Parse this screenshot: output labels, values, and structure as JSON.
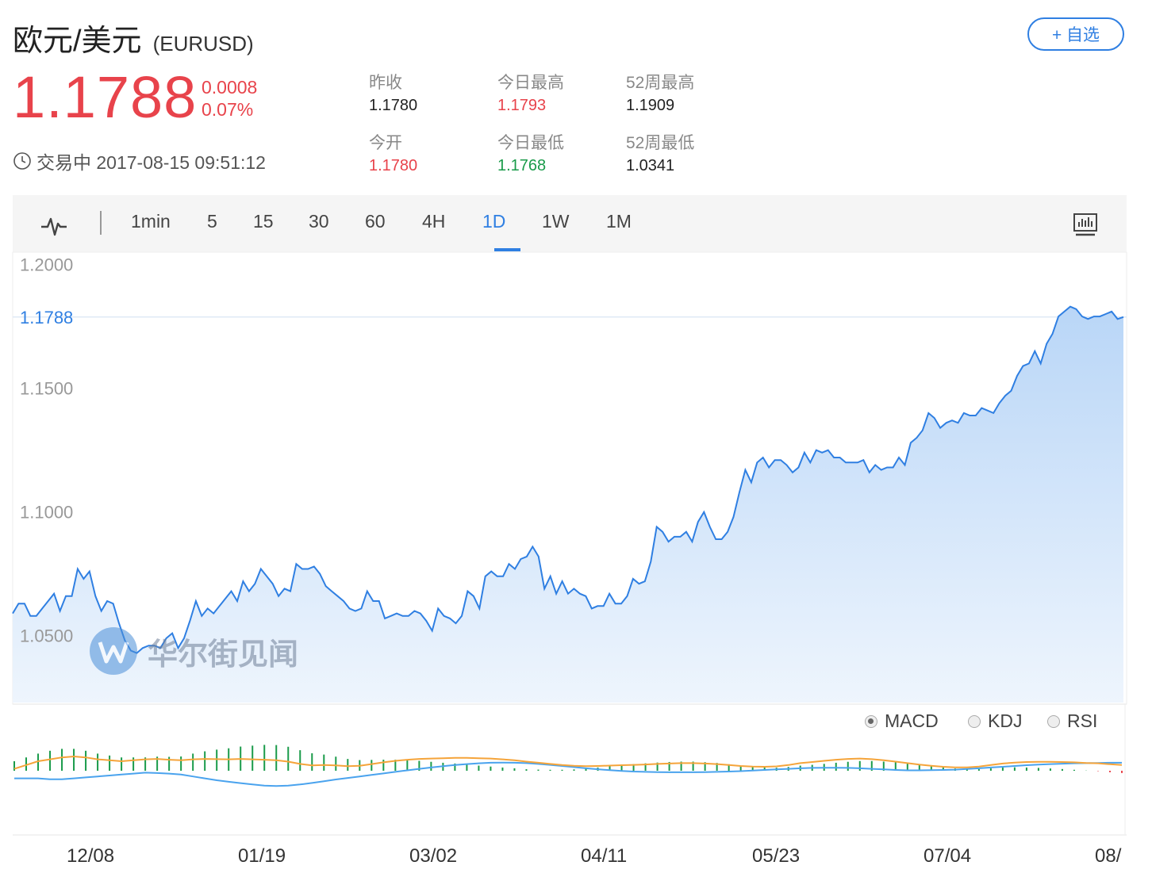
{
  "header": {
    "name": "欧元/美元",
    "code": "(EURUSD)",
    "watch_label": "+ 自选",
    "price": "1.1788",
    "change": "0.0008",
    "change_pct": "0.07%",
    "status": "交易中 2017-08-15 09:51:12"
  },
  "stats": [
    {
      "label": "昨收",
      "value": "1.1780",
      "tone": "neutral"
    },
    {
      "label": "今日最高",
      "value": "1.1793",
      "tone": "up"
    },
    {
      "label": "52周最高",
      "value": "1.1909",
      "tone": "neutral"
    },
    {
      "label": "今开",
      "value": "1.1780",
      "tone": "up"
    },
    {
      "label": "今日最低",
      "value": "1.1768",
      "tone": "down"
    },
    {
      "label": "52周最低",
      "value": "1.0341",
      "tone": "neutral"
    }
  ],
  "toolbar": {
    "periods": [
      "1min",
      "5",
      "15",
      "30",
      "60",
      "4H",
      "1D",
      "1W",
      "1M"
    ],
    "active": "1D",
    "left_icon": "line-chart-icon",
    "right_icon": "indicator-panel-icon"
  },
  "indicators": {
    "options": [
      "MACD",
      "KDJ",
      "RSI"
    ],
    "selected": "MACD"
  },
  "watermark": "华尔街见闻",
  "colors": {
    "up": "#e8434b",
    "down": "#1a9b4a",
    "accent": "#2f7fe2",
    "dif": "#4aa3ee",
    "dea": "#f5a43a"
  },
  "chart_data": {
    "type": "area",
    "y_ticks": [
      "1.2000",
      "1.1788",
      "1.1500",
      "1.1000",
      "1.0500"
    ],
    "x_ticks": [
      "12/08",
      "01/19",
      "03/02",
      "04/11",
      "05/23",
      "07/04",
      "08/"
    ],
    "ylim": [
      1.023,
      1.205
    ],
    "last_price_line": 1.1788,
    "values": [
      1.059,
      1.063,
      1.063,
      1.058,
      1.058,
      1.061,
      1.064,
      1.067,
      1.06,
      1.066,
      1.066,
      1.077,
      1.073,
      1.076,
      1.066,
      1.06,
      1.064,
      1.063,
      1.055,
      1.048,
      1.044,
      1.043,
      1.045,
      1.046,
      1.046,
      1.045,
      1.049,
      1.051,
      1.045,
      1.049,
      1.056,
      1.064,
      1.058,
      1.061,
      1.059,
      1.062,
      1.065,
      1.068,
      1.064,
      1.072,
      1.068,
      1.071,
      1.077,
      1.074,
      1.071,
      1.066,
      1.069,
      1.068,
      1.079,
      1.077,
      1.077,
      1.078,
      1.075,
      1.07,
      1.068,
      1.066,
      1.064,
      1.061,
      1.06,
      1.061,
      1.068,
      1.064,
      1.064,
      1.057,
      1.058,
      1.059,
      1.058,
      1.058,
      1.06,
      1.059,
      1.056,
      1.052,
      1.061,
      1.058,
      1.057,
      1.055,
      1.058,
      1.068,
      1.066,
      1.061,
      1.074,
      1.076,
      1.074,
      1.074,
      1.079,
      1.077,
      1.081,
      1.082,
      1.086,
      1.082,
      1.069,
      1.074,
      1.067,
      1.072,
      1.067,
      1.069,
      1.067,
      1.066,
      1.061,
      1.062,
      1.062,
      1.067,
      1.063,
      1.063,
      1.066,
      1.073,
      1.071,
      1.072,
      1.08,
      1.094,
      1.092,
      1.088,
      1.09,
      1.09,
      1.092,
      1.088,
      1.096,
      1.1,
      1.094,
      1.089,
      1.089,
      1.092,
      1.098,
      1.108,
      1.117,
      1.112,
      1.12,
      1.122,
      1.118,
      1.121,
      1.121,
      1.119,
      1.116,
      1.118,
      1.124,
      1.12,
      1.125,
      1.124,
      1.125,
      1.122,
      1.122,
      1.12,
      1.12,
      1.12,
      1.121,
      1.116,
      1.119,
      1.117,
      1.118,
      1.118,
      1.122,
      1.119,
      1.128,
      1.13,
      1.133,
      1.14,
      1.138,
      1.134,
      1.136,
      1.137,
      1.136,
      1.14,
      1.139,
      1.139,
      1.142,
      1.141,
      1.14,
      1.144,
      1.147,
      1.149,
      1.155,
      1.159,
      1.16,
      1.165,
      1.16,
      1.168,
      1.172,
      1.179,
      1.181,
      1.183,
      1.182,
      1.179,
      1.178,
      1.179,
      1.179,
      1.18,
      1.181,
      1.178,
      1.1788
    ],
    "macd": {
      "dif": [
        -0.004,
        -0.004,
        -0.004,
        -0.0045,
        -0.0045,
        -0.004,
        -0.0035,
        -0.003,
        -0.0025,
        -0.002,
        -0.0015,
        -0.001,
        -0.0012,
        -0.0015,
        -0.002,
        -0.003,
        -0.004,
        -0.005,
        -0.0058,
        -0.0065,
        -0.0072,
        -0.0078,
        -0.008,
        -0.0078,
        -0.0072,
        -0.0064,
        -0.0055,
        -0.0046,
        -0.0038,
        -0.003,
        -0.0022,
        -0.0014,
        -0.0006,
        0.0002,
        0.001,
        0.0017,
        0.0024,
        0.003,
        0.0035,
        0.0039,
        0.0042,
        0.0043,
        0.0042,
        0.004,
        0.0036,
        0.0031,
        0.0025,
        0.0019,
        0.0013,
        0.0008,
        0.0003,
        -0.0001,
        -0.0004,
        -0.0006,
        -0.0007,
        -0.0008,
        -0.0008,
        -0.0008,
        -0.0007,
        -0.0006,
        -0.0004,
        -0.0002,
        0.0001,
        0.0004,
        0.0007,
        0.001,
        0.0013,
        0.0015,
        0.0016,
        0.0016,
        0.0015,
        0.0013,
        0.001,
        0.0007,
        0.0004,
        0.0002,
        0.0002,
        0.0003,
        0.0004,
        0.0006,
        0.0009,
        0.0013,
        0.0017,
        0.0021,
        0.0025,
        0.0029,
        0.0032,
        0.0035,
        0.0037,
        0.0039,
        0.004,
        0.0041,
        0.0042,
        0.0042
      ],
      "dea": [
        0.001,
        0.003,
        0.005,
        0.006,
        0.007,
        0.0075,
        0.007,
        0.006,
        0.0055,
        0.005,
        0.0055,
        0.006,
        0.0062,
        0.0058,
        0.0055,
        0.006,
        0.0062,
        0.0061,
        0.006,
        0.0062,
        0.006,
        0.0058,
        0.0055,
        0.0048,
        0.0036,
        0.0028,
        0.003,
        0.0028,
        0.0024,
        0.0026,
        0.0035,
        0.0044,
        0.0052,
        0.0058,
        0.0062,
        0.0064,
        0.0066,
        0.0068,
        0.0068,
        0.0066,
        0.0064,
        0.006,
        0.0055,
        0.0048,
        0.0042,
        0.0036,
        0.003,
        0.0026,
        0.0024,
        0.0025,
        0.0027,
        0.0029,
        0.0031,
        0.0033,
        0.0036,
        0.0038,
        0.004,
        0.004,
        0.0038,
        0.0035,
        0.003,
        0.0025,
        0.0022,
        0.0021,
        0.0023,
        0.003,
        0.004,
        0.0046,
        0.0052,
        0.0058,
        0.0062,
        0.0064,
        0.0061,
        0.0055,
        0.0048,
        0.004,
        0.0032,
        0.0026,
        0.0021,
        0.0018,
        0.0018,
        0.0022,
        0.003,
        0.0038,
        0.0043,
        0.0046,
        0.0047,
        0.0047,
        0.0046,
        0.0044,
        0.0041,
        0.0039,
        0.0034,
        0.003
      ]
    }
  }
}
